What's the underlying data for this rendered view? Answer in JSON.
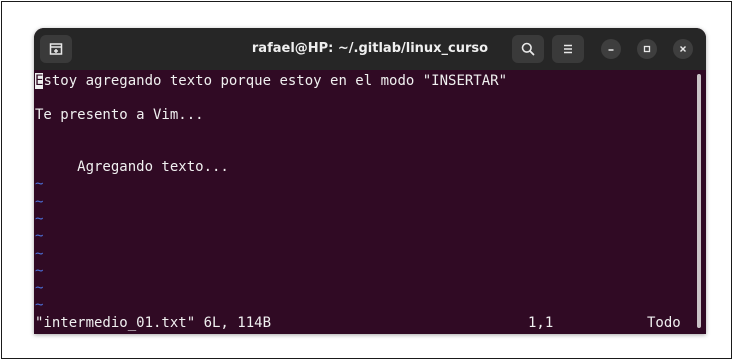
{
  "window": {
    "title": "rafael@HP: ~/.gitlab/linux_curso"
  },
  "terminal": {
    "lines": [
      {
        "text": "Estoy agregando texto porque estoy en el modo \"INSERTAR\""
      },
      {
        "text": "Te presento a Vim..."
      },
      {
        "text": "     Agregando texto..."
      }
    ],
    "tilde": "~",
    "status": {
      "file_info": "\"intermedio_01.txt\" 6L, 114B",
      "position": "1,1",
      "scroll": "Todo"
    }
  },
  "colors": {
    "terminal_bg": "#300a24",
    "titlebar_bg": "#262626",
    "tilde": "#4b6fd8",
    "text": "#f0f0f0"
  },
  "icons": [
    "new-tab-icon",
    "search-icon",
    "hamburger-menu-icon",
    "minimize-icon",
    "maximize-icon",
    "close-icon"
  ]
}
